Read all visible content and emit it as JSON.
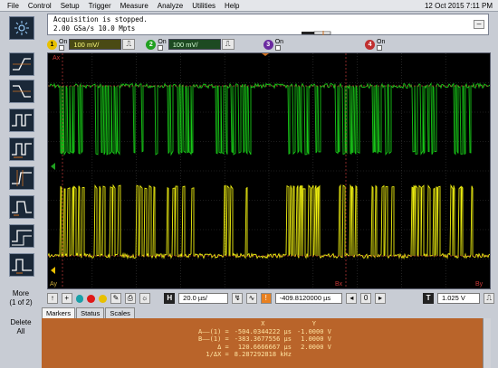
{
  "menubar": {
    "items": [
      "File",
      "Control",
      "Setup",
      "Trigger",
      "Measure",
      "Analyze",
      "Utilities",
      "Help"
    ],
    "datetime": "12 Oct 2015  7:11 PM"
  },
  "status": {
    "line1": "Acquisition is stopped.",
    "line2": "2.00 GSa/s   10.0 Mpts"
  },
  "channels": [
    {
      "num": "1",
      "on_label": "On",
      "scale": "100 mV/",
      "color": "#e8c000",
      "has_scale": true
    },
    {
      "num": "2",
      "on_label": "On",
      "scale": "100 mV/",
      "color": "#20a020",
      "has_scale": true
    },
    {
      "num": "3",
      "on_label": "On",
      "scale": "",
      "color": "#6a2aa0",
      "has_scale": false
    },
    {
      "num": "4",
      "on_label": "On",
      "scale": "",
      "color": "#c03030",
      "has_scale": false
    }
  ],
  "sidebar": {
    "more_label_1": "More",
    "more_label_2": "(1 of 2)",
    "delete_label_1": "Delete",
    "delete_label_2": "All"
  },
  "controls": {
    "horizontal_scale": "20.0 µs/",
    "horizontal_position": "-409.8120000 µs",
    "trigger_level": "1.025 V",
    "h_label": "H",
    "t_label": "T"
  },
  "tabs": [
    "Markers",
    "Status",
    "Scales"
  ],
  "readout": {
    "col_x": "X",
    "col_y": "Y",
    "rows": [
      {
        "label": "A——(1) =",
        "x": "-504.0344222 µs",
        "y": "-1.0000 V"
      },
      {
        "label": "B——(1) =",
        "x": "-383.3677556 µs",
        "y": "1.0000 V"
      },
      {
        "label": "Δ =",
        "x": "120.6666667 µs",
        "y": "2.0000 V"
      },
      {
        "label": "1/ΔX =",
        "x": "8.287292818 kHz",
        "y": ""
      }
    ]
  },
  "colors": {
    "green_trace": "#18c818",
    "yellow_trace": "#f0f010",
    "screen_bg": "#000000",
    "readout_bg": "#b9642a"
  }
}
